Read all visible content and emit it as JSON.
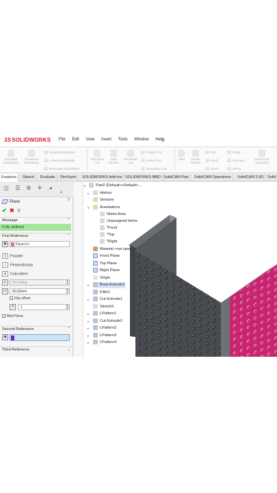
{
  "app": {
    "logo_prefix": "3S",
    "logo_text": "SOLIDWORKS"
  },
  "menu": [
    "File",
    "Edit",
    "View",
    "Insert",
    "Tools",
    "Window",
    "Help"
  ],
  "toolbar": {
    "extruded_boss": "Extruded Boss/Base",
    "revolved_boss": "Revolved Boss/Base",
    "swept_boss": "Swept Boss/Base",
    "lofted_boss": "Lofted Boss/Base",
    "boundary_boss": "Boundary Boss/Base",
    "extruded_cut": "Extruded Cut",
    "hole_wizard": "Hole Wizard",
    "revolved_cut": "Revolved Cut",
    "swept_cut": "Swept Cut",
    "lofted_cut": "Lofted Cut",
    "boundary_cut": "Boundary Cut",
    "fillet": "Fillet",
    "linear_pattern": "Linear Pattern",
    "rib": "Rib",
    "draft": "Draft",
    "shell": "Shell",
    "wrap": "Wrap",
    "intersect": "Intersect",
    "mirror": "Mirror",
    "reference_geometry": "Reference Geometry"
  },
  "tabs": [
    "Features",
    "Sketch",
    "Evaluate",
    "DimXpert",
    "SOLIDWORKS Add-Ins",
    "SOLIDWORKS MBD",
    "SolidCAM Part",
    "SolidCAM Operations",
    "SolidCAM 2.5D",
    "Solid"
  ],
  "panel": {
    "title": "Plane",
    "help": "?",
    "message_header": "Message",
    "message": "Fully defined",
    "first_reference": "First Reference",
    "first_ref_value": "Face<1>",
    "options": [
      "Parallel",
      "Perpendicular",
      "Coincident"
    ],
    "angle_value": "90.00deg",
    "offset_value": "60.00mm",
    "flip_offset": "Flip offset",
    "count_value": "1",
    "mid_plane": "Mid Plane",
    "second_reference": "Second Reference",
    "third_reference": "Third Reference"
  },
  "tree": {
    "root": "Part2  (Default<<Default>...",
    "items": [
      "History",
      "Sensors",
      "Annotations",
      "Notes Area",
      "Unassigned Items",
      "*Front",
      "*Top",
      "*Right",
      "Material <not spec...>",
      "Front Plane",
      "Top Plane",
      "Right Plane",
      "Origin",
      "Boss-Extrude1",
      "Fillet1",
      "Cut-Extrude1",
      "Sketch3",
      "LPattern1",
      "Cut-Extrude2",
      "LPattern2",
      "LPattern3",
      "LPattern4"
    ]
  },
  "colors": {
    "accent_red": "#d71920",
    "message_green": "#a3e59b",
    "face_magenta": "#d0287a",
    "body_grey": "#4a4d52",
    "selection_purple": "#7a1fd1",
    "field_blue": "#cfe3f7"
  }
}
